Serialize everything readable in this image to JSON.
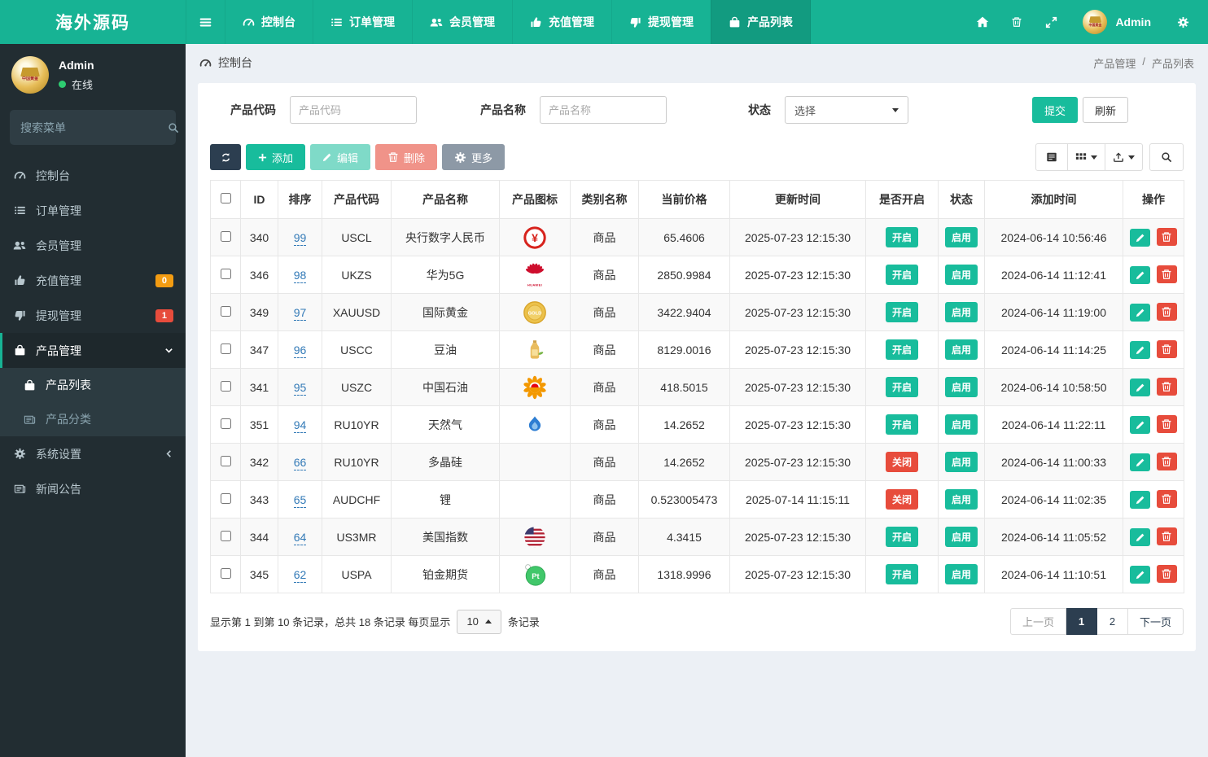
{
  "brand": {
    "title": "海外源码"
  },
  "colors": {
    "accent": "#18bc9c",
    "navbar": "#17b394",
    "dark": "#2c3e50",
    "danger": "#e74c3c",
    "warning": "#f39c12",
    "sidebar": "#222d32",
    "link": "#337ab7"
  },
  "navbar": {
    "items": [
      {
        "key": "dashboard",
        "label": "控制台",
        "icon": "dashboard-icon"
      },
      {
        "key": "orders",
        "label": "订单管理",
        "icon": "list-icon"
      },
      {
        "key": "members",
        "label": "会员管理",
        "icon": "users-icon"
      },
      {
        "key": "recharge",
        "label": "充值管理",
        "icon": "thumbs-up-icon"
      },
      {
        "key": "withdraw",
        "label": "提现管理",
        "icon": "thumbs-down-icon"
      },
      {
        "key": "product-list",
        "label": "产品列表",
        "icon": "bag-icon",
        "active": true
      }
    ],
    "right_icons": [
      "home-icon",
      "trash-icon",
      "expand-icon"
    ],
    "user": {
      "name": "Admin"
    },
    "settings_icon": "gears-icon"
  },
  "sidebar": {
    "user": {
      "name": "Admin",
      "status": "在线"
    },
    "search_placeholder": "搜索菜单",
    "items": [
      {
        "key": "dashboard",
        "label": "控制台",
        "icon": "dashboard-icon"
      },
      {
        "key": "orders",
        "label": "订单管理",
        "icon": "list-icon"
      },
      {
        "key": "members",
        "label": "会员管理",
        "icon": "users-icon"
      },
      {
        "key": "recharge",
        "label": "充值管理",
        "icon": "thumbs-up-icon",
        "badge": "0",
        "badge_color": "#f39c12"
      },
      {
        "key": "withdraw",
        "label": "提现管理",
        "icon": "thumbs-down-icon",
        "badge": "1",
        "badge_color": "#e74c3c"
      },
      {
        "key": "products",
        "label": "产品管理",
        "icon": "bag-icon",
        "active": true,
        "chevron": "down",
        "children": [
          {
            "key": "product-list",
            "label": "产品列表",
            "icon": "bag-icon",
            "active": true
          },
          {
            "key": "product-category",
            "label": "产品分类",
            "icon": "news-icon"
          }
        ]
      },
      {
        "key": "system-settings",
        "label": "系统设置",
        "icon": "gears-icon",
        "chevron": "left"
      },
      {
        "key": "news",
        "label": "新闻公告",
        "icon": "news-icon"
      }
    ]
  },
  "breadcrumb": {
    "left_label": "控制台",
    "right": [
      "产品管理",
      "产品列表"
    ],
    "separator": "/"
  },
  "filters": {
    "code_label": "产品代码",
    "code_placeholder": "产品代码",
    "name_label": "产品名称",
    "name_placeholder": "产品名称",
    "status_label": "状态",
    "status_value": "选择",
    "submit_label": "提交",
    "refresh_label": "刷新"
  },
  "toolbar": {
    "add_label": "添加",
    "edit_label": "编辑",
    "delete_label": "删除",
    "more_label": "更多"
  },
  "table": {
    "headers": [
      "ID",
      "排序",
      "产品代码",
      "产品名称",
      "产品图标",
      "类别名称",
      "当前价格",
      "更新时间",
      "是否开启",
      "状态",
      "添加时间",
      "操作"
    ],
    "rows": [
      {
        "id": "340",
        "sort": "99",
        "code": "USCL",
        "name": "央行数字人民币",
        "icon": "pboc-yuan-icon",
        "category": "商品",
        "price": "65.4606",
        "updated": "2025-07-23 12:15:30",
        "open": {
          "label": "开启",
          "on": true
        },
        "status": {
          "label": "启用",
          "on": true
        },
        "added": "2024-06-14 10:56:46"
      },
      {
        "id": "346",
        "sort": "98",
        "code": "UKZS",
        "name": "华为5G",
        "icon": "huawei-icon",
        "category": "商品",
        "price": "2850.9984",
        "updated": "2025-07-23 12:15:30",
        "open": {
          "label": "开启",
          "on": true
        },
        "status": {
          "label": "启用",
          "on": true
        },
        "added": "2024-06-14 11:12:41"
      },
      {
        "id": "349",
        "sort": "97",
        "code": "XAUUSD",
        "name": "国际黄金",
        "icon": "gold-coin-icon",
        "category": "商品",
        "price": "3422.9404",
        "updated": "2025-07-23 12:15:30",
        "open": {
          "label": "开启",
          "on": true
        },
        "status": {
          "label": "启用",
          "on": true
        },
        "added": "2024-06-14 11:19:00"
      },
      {
        "id": "347",
        "sort": "96",
        "code": "USCC",
        "name": "豆油",
        "icon": "oil-bottle-icon",
        "category": "商品",
        "price": "8129.0016",
        "updated": "2025-07-23 12:15:30",
        "open": {
          "label": "开启",
          "on": true
        },
        "status": {
          "label": "启用",
          "on": true
        },
        "added": "2024-06-14 11:14:25"
      },
      {
        "id": "341",
        "sort": "95",
        "code": "USZC",
        "name": "中国石油",
        "icon": "petrochina-icon",
        "category": "商品",
        "price": "418.5015",
        "updated": "2025-07-23 12:15:30",
        "open": {
          "label": "开启",
          "on": true
        },
        "status": {
          "label": "启用",
          "on": true
        },
        "added": "2024-06-14 10:58:50"
      },
      {
        "id": "351",
        "sort": "94",
        "code": "RU10YR",
        "name": "天然气",
        "icon": "gas-flame-icon",
        "category": "商品",
        "price": "14.2652",
        "updated": "2025-07-23 12:15:30",
        "open": {
          "label": "开启",
          "on": true
        },
        "status": {
          "label": "启用",
          "on": true
        },
        "added": "2024-06-14 11:22:11"
      },
      {
        "id": "342",
        "sort": "66",
        "code": "RU10YR",
        "name": "多晶硅",
        "icon": "",
        "category": "商品",
        "price": "14.2652",
        "updated": "2025-07-23 12:15:30",
        "open": {
          "label": "关闭",
          "on": false
        },
        "status": {
          "label": "启用",
          "on": true
        },
        "added": "2024-06-14 11:00:33"
      },
      {
        "id": "343",
        "sort": "65",
        "code": "AUDCHF",
        "name": "锂",
        "icon": "",
        "category": "商品",
        "price": "0.523005473",
        "updated": "2025-07-14 11:15:11",
        "open": {
          "label": "关闭",
          "on": false
        },
        "status": {
          "label": "启用",
          "on": true
        },
        "added": "2024-06-14 11:02:35"
      },
      {
        "id": "344",
        "sort": "64",
        "code": "US3MR",
        "name": "美国指数",
        "icon": "us-flag-icon",
        "category": "商品",
        "price": "4.3415",
        "updated": "2025-07-23 12:15:30",
        "open": {
          "label": "开启",
          "on": true
        },
        "status": {
          "label": "启用",
          "on": true
        },
        "added": "2024-06-14 11:05:52"
      },
      {
        "id": "345",
        "sort": "62",
        "code": "USPA",
        "name": "铂金期货",
        "icon": "platinum-icon",
        "category": "商品",
        "price": "1318.9996",
        "updated": "2025-07-23 12:15:30",
        "open": {
          "label": "开启",
          "on": true
        },
        "status": {
          "label": "启用",
          "on": true
        },
        "added": "2024-06-14 11:10:51"
      }
    ]
  },
  "pagination": {
    "info_prefix": "显示第 1 到第 10 条记录，总共 18 条记录 每页显示",
    "page_size": "10",
    "info_suffix": "条记录",
    "prev_label": "上一页",
    "pages": [
      "1",
      "2"
    ],
    "active_page": "1",
    "next_label": "下一页"
  }
}
